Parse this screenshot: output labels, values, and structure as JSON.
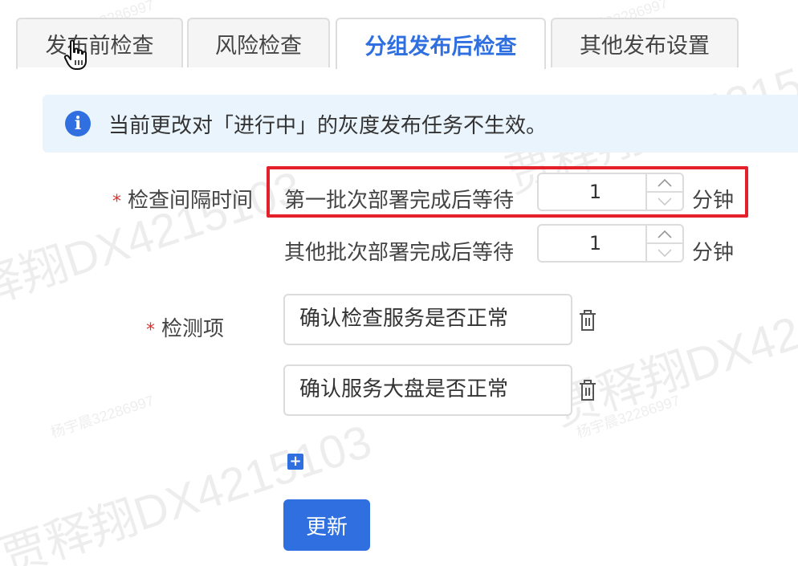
{
  "tabs": [
    {
      "label": "发布前检查",
      "active": false
    },
    {
      "label": "风险检查",
      "active": false
    },
    {
      "label": "分组发布后检查",
      "active": true
    },
    {
      "label": "其他发布设置",
      "active": false
    }
  ],
  "alert": {
    "icon": "info-icon",
    "icon_glyph": "i",
    "text": "当前更改对「进行中」的灰度发布任务不生效。"
  },
  "interval": {
    "label": "检查间隔时间",
    "required_mark": "*",
    "first_batch_text": "第一批次部署完成后等待",
    "first_batch_value": "1",
    "other_batch_text": "其他批次部署完成后等待",
    "other_batch_value": "1",
    "unit": "分钟"
  },
  "check_items": {
    "label": "检测项",
    "required_mark": "*",
    "items": [
      {
        "value": "确认检查服务是否正常"
      },
      {
        "value": "确认服务大盘是否正常"
      }
    ],
    "add_glyph": "+"
  },
  "actions": {
    "update_label": "更新"
  },
  "watermarks": {
    "big_a": "贾释翔DX4215103",
    "big_b": "贾释翔DX421510",
    "big_c": "贾释翔DX4215",
    "big_d": "释翔DX4215103",
    "small_a": "杨宇晨32286997",
    "small_b": "杨宇晨32286997",
    "small_c": "杨宇晨32286997",
    "small_d": "杨宇晨32286997"
  },
  "colors": {
    "primary": "#2f6fe0",
    "highlight": "#e4202a",
    "required": "#e0312f",
    "alert_bg": "#eaf4fd"
  }
}
